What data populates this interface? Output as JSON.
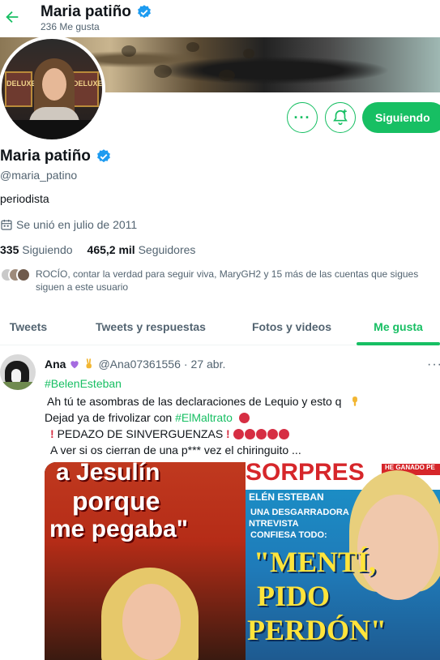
{
  "header": {
    "title": "Maria patiño",
    "subtitle": "236 Me gusta"
  },
  "profile": {
    "name": "Maria patiño",
    "handle": "@maria_patino",
    "bio": "periodista",
    "joined": "Se unió en julio de 2011",
    "following_count": "335",
    "following_label": "Siguiendo",
    "followers_count": "465,2 mil",
    "followers_label": "Seguidores",
    "followers_you_know": "ROCÍO, contar la verdad para seguir viva, MaryGH2 y 15 más de las cuentas que sigues siguen a este usuario",
    "avatar_sign_left": "DELUXE",
    "avatar_sign_right": "DELUXE"
  },
  "actions": {
    "more_label": "···",
    "follow_label": "Siguiendo"
  },
  "tabs": [
    {
      "label": "Tweets"
    },
    {
      "label": "Tweets y respuestas"
    },
    {
      "label": "Fotos y videos"
    },
    {
      "label": "Me gusta"
    }
  ],
  "tweet": {
    "name": "Ana",
    "handle": "@Ana07361556",
    "date": "27 abr.",
    "more_label": "···",
    "hashtag1": "#BelenEsteban",
    "line2": "Ah tú te asombras de las  declaraciones de Lequio y esto q",
    "line3_prefix": "Dejad ya de  frivolizar con",
    "hashtag2": "#ElMaltrato",
    "line4": "PEDAZO DE SINVERGUENZAS",
    "line5": "A ver si os cierran de una p*** vez el chiringuito ..."
  },
  "media": {
    "left_line1": "a Jesulín",
    "left_line2": "porque",
    "left_line3": "me pegaba\"",
    "right_header": "SORPRES",
    "right_badge": "HE GANADO PE",
    "right_line1": "ELÉN ESTEBAN",
    "right_line2": "UNA DESGARRADORA",
    "right_line3": "NTREVISTA",
    "right_line4": "CONFIESA TODO:",
    "right_big1": "\"MENTÍ,",
    "right_big2": "PIDO",
    "right_big3": "PERDÓN\""
  },
  "colors": {
    "accent": "#17bf63",
    "text": "#0f1419",
    "muted": "#536471",
    "verified": "#1d9bf0"
  }
}
